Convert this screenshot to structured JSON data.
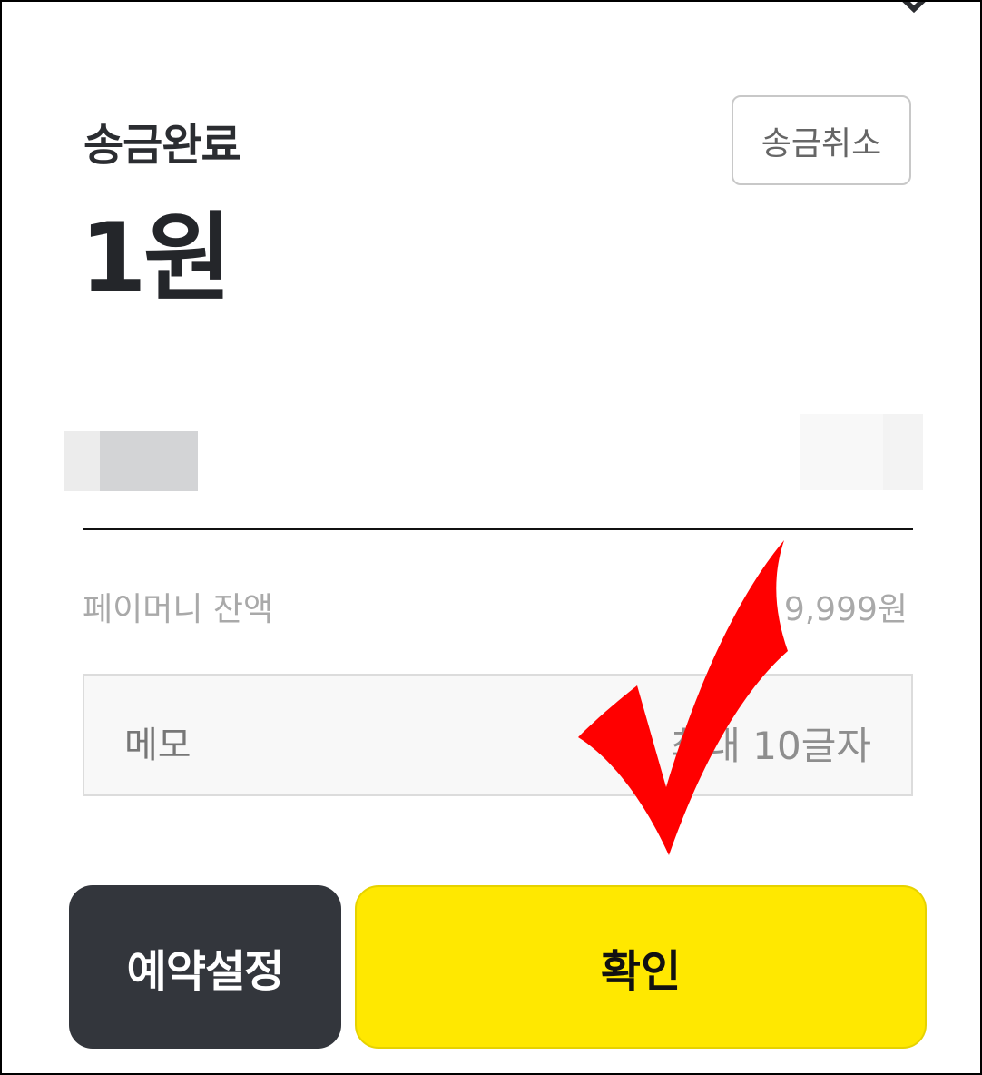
{
  "header": {
    "title": "송금완료",
    "amount": "1원",
    "cancel_button_label": "송금취소"
  },
  "balance": {
    "label": "페이머니 잔액",
    "value": "9,999원"
  },
  "memo": {
    "label": "메모",
    "hint": "최대 10글자"
  },
  "actions": {
    "reserve_label": "예약설정",
    "confirm_label": "확인"
  },
  "colors": {
    "confirm_bg": "#ffe800",
    "reserve_bg": "#33363c",
    "annotation_check": "#ff0000"
  },
  "icons": {
    "close": "close-icon",
    "annotation": "checkmark-annotation-icon"
  }
}
